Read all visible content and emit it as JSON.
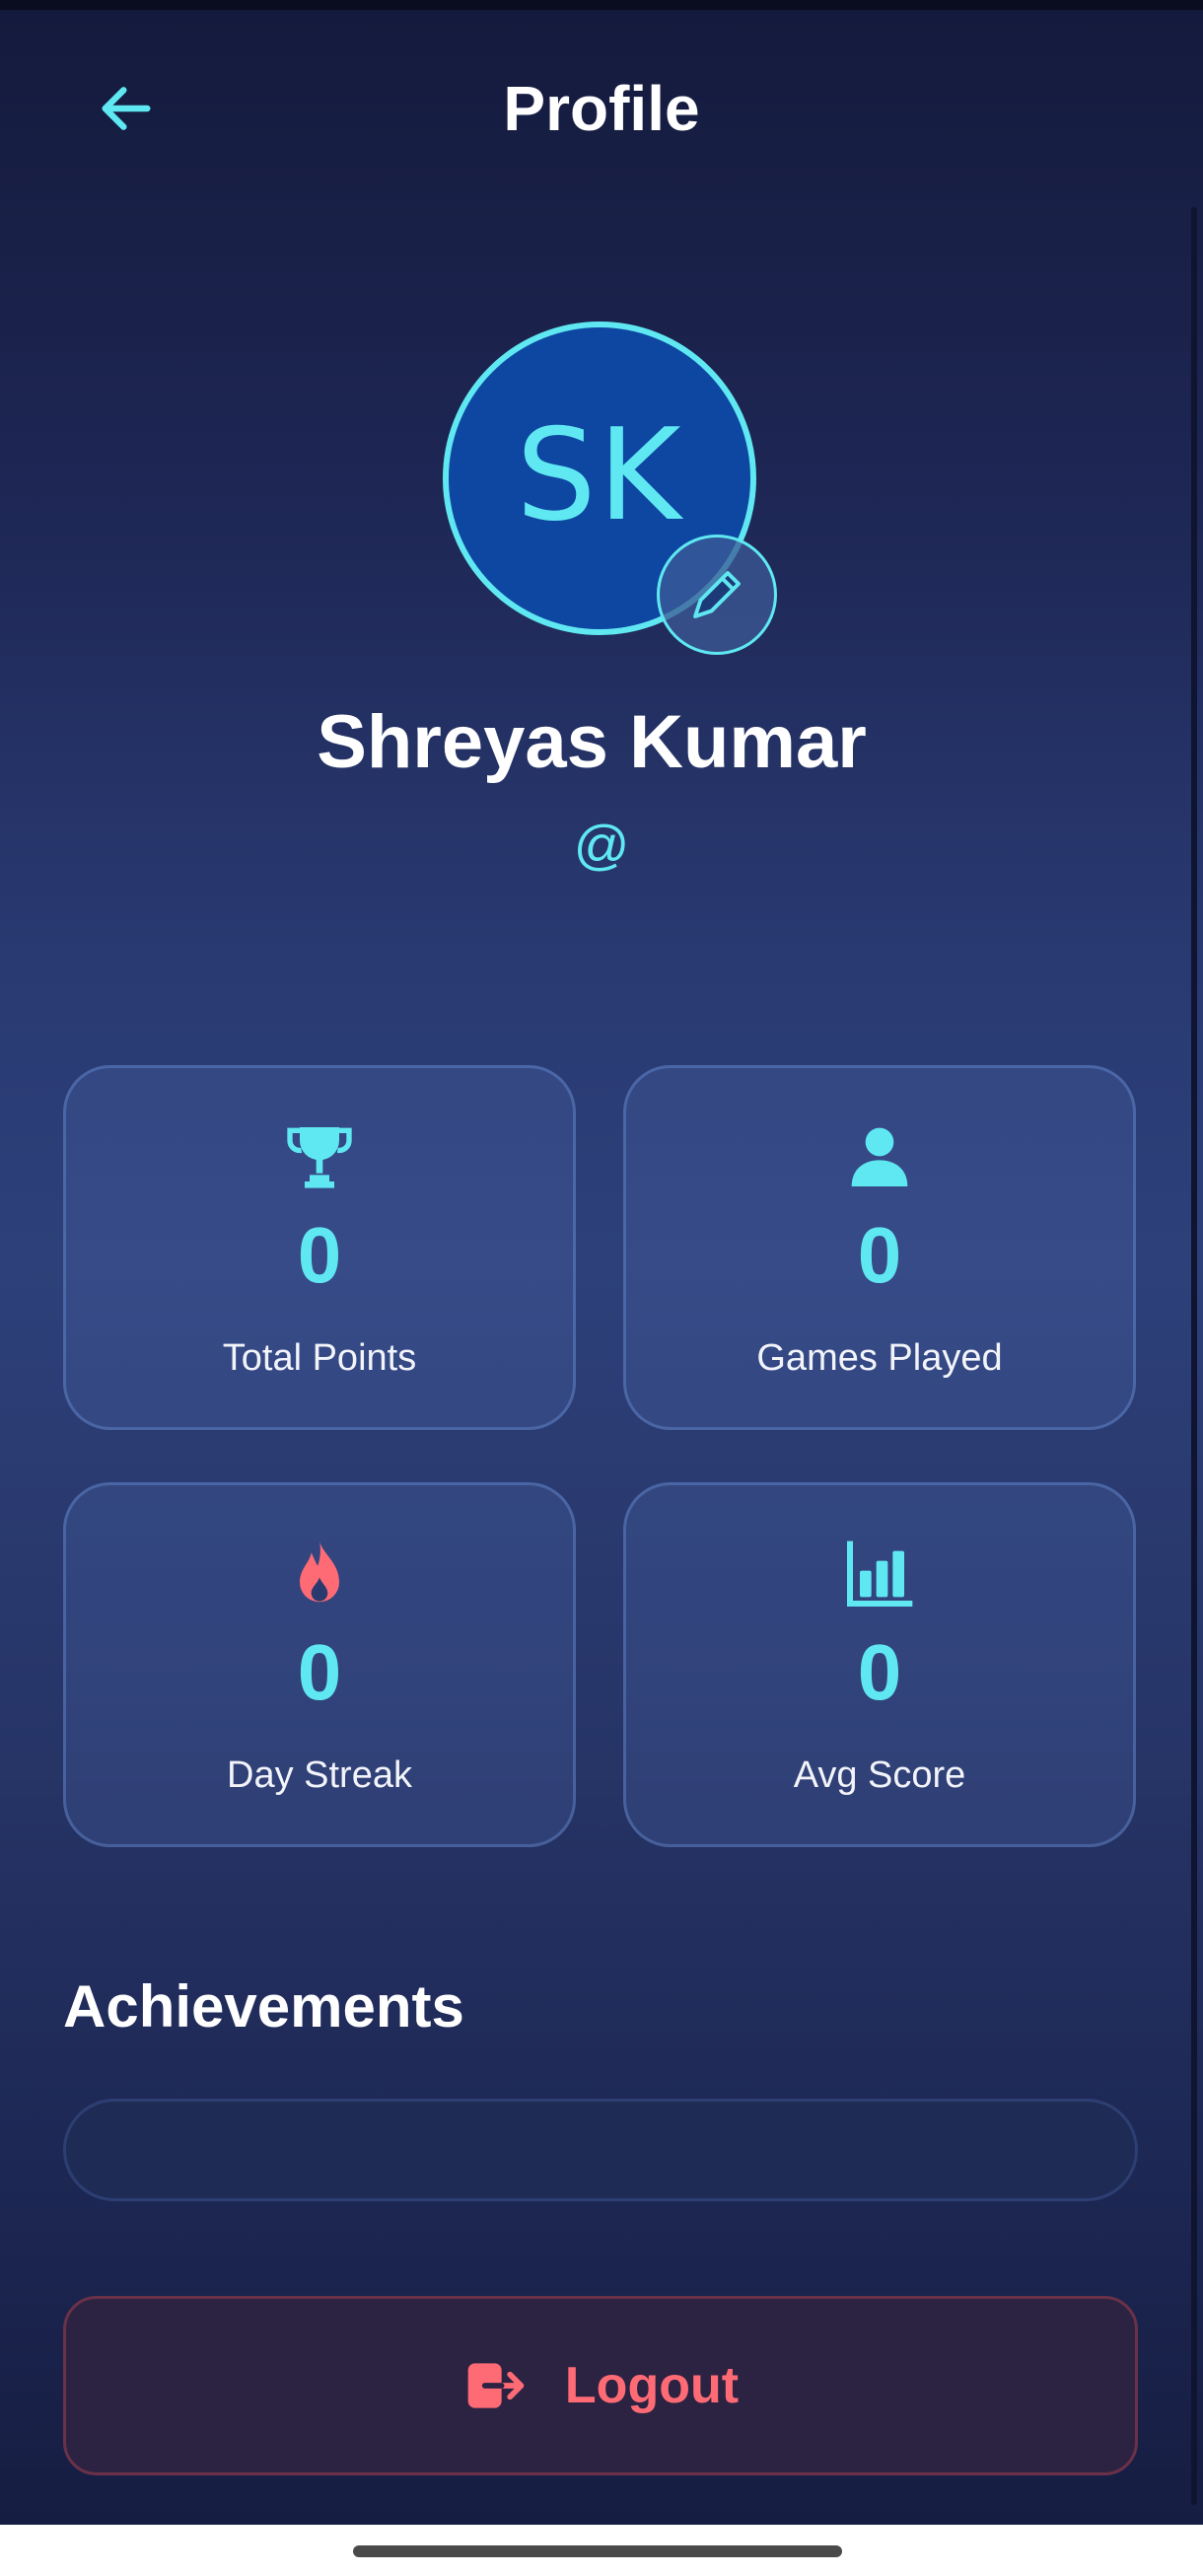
{
  "header": {
    "title": "Profile",
    "back_icon": "arrow-left-icon"
  },
  "profile": {
    "initials": "SK",
    "name": "Shreyas Kumar",
    "handle": "@",
    "edit_icon": "pencil-icon"
  },
  "stats": [
    {
      "icon": "trophy-icon",
      "value": "0",
      "label": "Total Points"
    },
    {
      "icon": "person-icon",
      "value": "0",
      "label": "Games Played"
    },
    {
      "icon": "flame-icon",
      "value": "0",
      "label": "Day Streak"
    },
    {
      "icon": "bar-chart-icon",
      "value": "0",
      "label": "Avg Score"
    }
  ],
  "achievements": {
    "title": "Achievements"
  },
  "logout": {
    "label": "Logout",
    "icon": "logout-icon"
  },
  "colors": {
    "accent": "#5fe8f2",
    "danger": "#ff6b74",
    "avatar_bg": "#0e47a1",
    "background_top": "#141a3c",
    "background_mid": "#2d4079"
  }
}
